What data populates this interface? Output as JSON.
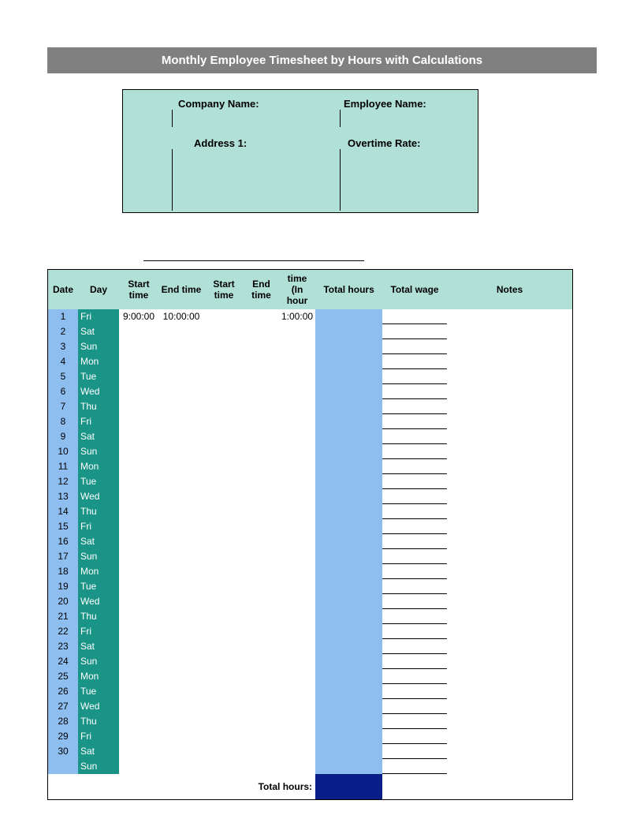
{
  "title": "Monthly Employee Timesheet by Hours with Calculations",
  "info": {
    "company_name_label": "Company Name:",
    "employee_name_label": "Employee Name:",
    "address1_label": "Address 1:",
    "overtime_rate_label": "Overtime Rate:"
  },
  "headers": {
    "date": "Date",
    "day": "Day",
    "start1": "Start time",
    "end1": "End time",
    "start2": "Start time",
    "end2": "End time",
    "time_in_hour": "time (In hour",
    "total_hours": "Total hours",
    "total_wage": "Total wage",
    "notes": "Notes"
  },
  "rows": [
    {
      "date": "1",
      "day": "Fri",
      "start1": "9:00:00",
      "end1": "10:00:00",
      "start2": "",
      "end2": "",
      "tih": "1:00:00",
      "thrs": "",
      "twage": "",
      "notes": ""
    },
    {
      "date": "2",
      "day": "Sat",
      "start1": "",
      "end1": "",
      "start2": "",
      "end2": "",
      "tih": "",
      "thrs": "",
      "twage": "",
      "notes": ""
    },
    {
      "date": "3",
      "day": "Sun",
      "start1": "",
      "end1": "",
      "start2": "",
      "end2": "",
      "tih": "",
      "thrs": "",
      "twage": "",
      "notes": ""
    },
    {
      "date": "4",
      "day": "Mon",
      "start1": "",
      "end1": "",
      "start2": "",
      "end2": "",
      "tih": "",
      "thrs": "",
      "twage": "",
      "notes": ""
    },
    {
      "date": "5",
      "day": "Tue",
      "start1": "",
      "end1": "",
      "start2": "",
      "end2": "",
      "tih": "",
      "thrs": "",
      "twage": "",
      "notes": ""
    },
    {
      "date": "6",
      "day": "Wed",
      "start1": "",
      "end1": "",
      "start2": "",
      "end2": "",
      "tih": "",
      "thrs": "",
      "twage": "",
      "notes": ""
    },
    {
      "date": "7",
      "day": "Thu",
      "start1": "",
      "end1": "",
      "start2": "",
      "end2": "",
      "tih": "",
      "thrs": "",
      "twage": "",
      "notes": ""
    },
    {
      "date": "8",
      "day": "Fri",
      "start1": "",
      "end1": "",
      "start2": "",
      "end2": "",
      "tih": "",
      "thrs": "",
      "twage": "",
      "notes": ""
    },
    {
      "date": "9",
      "day": "Sat",
      "start1": "",
      "end1": "",
      "start2": "",
      "end2": "",
      "tih": "",
      "thrs": "",
      "twage": "",
      "notes": ""
    },
    {
      "date": "10",
      "day": "Sun",
      "start1": "",
      "end1": "",
      "start2": "",
      "end2": "",
      "tih": "",
      "thrs": "",
      "twage": "",
      "notes": ""
    },
    {
      "date": "11",
      "day": "Mon",
      "start1": "",
      "end1": "",
      "start2": "",
      "end2": "",
      "tih": "",
      "thrs": "",
      "twage": "",
      "notes": ""
    },
    {
      "date": "12",
      "day": "Tue",
      "start1": "",
      "end1": "",
      "start2": "",
      "end2": "",
      "tih": "",
      "thrs": "",
      "twage": "",
      "notes": ""
    },
    {
      "date": "13",
      "day": "Wed",
      "start1": "",
      "end1": "",
      "start2": "",
      "end2": "",
      "tih": "",
      "thrs": "",
      "twage": "",
      "notes": ""
    },
    {
      "date": "14",
      "day": "Thu",
      "start1": "",
      "end1": "",
      "start2": "",
      "end2": "",
      "tih": "",
      "thrs": "",
      "twage": "",
      "notes": ""
    },
    {
      "date": "15",
      "day": "Fri",
      "start1": "",
      "end1": "",
      "start2": "",
      "end2": "",
      "tih": "",
      "thrs": "",
      "twage": "",
      "notes": ""
    },
    {
      "date": "16",
      "day": "Sat",
      "start1": "",
      "end1": "",
      "start2": "",
      "end2": "",
      "tih": "",
      "thrs": "",
      "twage": "",
      "notes": ""
    },
    {
      "date": "17",
      "day": "Sun",
      "start1": "",
      "end1": "",
      "start2": "",
      "end2": "",
      "tih": "",
      "thrs": "",
      "twage": "",
      "notes": ""
    },
    {
      "date": "18",
      "day": "Mon",
      "start1": "",
      "end1": "",
      "start2": "",
      "end2": "",
      "tih": "",
      "thrs": "",
      "twage": "",
      "notes": ""
    },
    {
      "date": "19",
      "day": "Tue",
      "start1": "",
      "end1": "",
      "start2": "",
      "end2": "",
      "tih": "",
      "thrs": "",
      "twage": "",
      "notes": ""
    },
    {
      "date": "20",
      "day": "Wed",
      "start1": "",
      "end1": "",
      "start2": "",
      "end2": "",
      "tih": "",
      "thrs": "",
      "twage": "",
      "notes": ""
    },
    {
      "date": "21",
      "day": "Thu",
      "start1": "",
      "end1": "",
      "start2": "",
      "end2": "",
      "tih": "",
      "thrs": "",
      "twage": "",
      "notes": ""
    },
    {
      "date": "22",
      "day": "Fri",
      "start1": "",
      "end1": "",
      "start2": "",
      "end2": "",
      "tih": "",
      "thrs": "",
      "twage": "",
      "notes": ""
    },
    {
      "date": "23",
      "day": "Sat",
      "start1": "",
      "end1": "",
      "start2": "",
      "end2": "",
      "tih": "",
      "thrs": "",
      "twage": "",
      "notes": ""
    },
    {
      "date": "24",
      "day": "Sun",
      "start1": "",
      "end1": "",
      "start2": "",
      "end2": "",
      "tih": "",
      "thrs": "",
      "twage": "",
      "notes": ""
    },
    {
      "date": "25",
      "day": "Mon",
      "start1": "",
      "end1": "",
      "start2": "",
      "end2": "",
      "tih": "",
      "thrs": "",
      "twage": "",
      "notes": ""
    },
    {
      "date": "26",
      "day": "Tue",
      "start1": "",
      "end1": "",
      "start2": "",
      "end2": "",
      "tih": "",
      "thrs": "",
      "twage": "",
      "notes": ""
    },
    {
      "date": "27",
      "day": "Wed",
      "start1": "",
      "end1": "",
      "start2": "",
      "end2": "",
      "tih": "",
      "thrs": "",
      "twage": "",
      "notes": ""
    },
    {
      "date": "28",
      "day": "Thu",
      "start1": "",
      "end1": "",
      "start2": "",
      "end2": "",
      "tih": "",
      "thrs": "",
      "twage": "",
      "notes": ""
    },
    {
      "date": "29",
      "day": "Fri",
      "start1": "",
      "end1": "",
      "start2": "",
      "end2": "",
      "tih": "",
      "thrs": "",
      "twage": "",
      "notes": ""
    },
    {
      "date": "30",
      "day": "Sat",
      "start1": "",
      "end1": "",
      "start2": "",
      "end2": "",
      "tih": "",
      "thrs": "",
      "twage": "",
      "notes": ""
    },
    {
      "date": "",
      "day": "Sun",
      "start1": "",
      "end1": "",
      "start2": "",
      "end2": "",
      "tih": "",
      "thrs": "",
      "twage": "",
      "notes": ""
    }
  ],
  "totals": {
    "label": "Total hours:",
    "value": ""
  }
}
